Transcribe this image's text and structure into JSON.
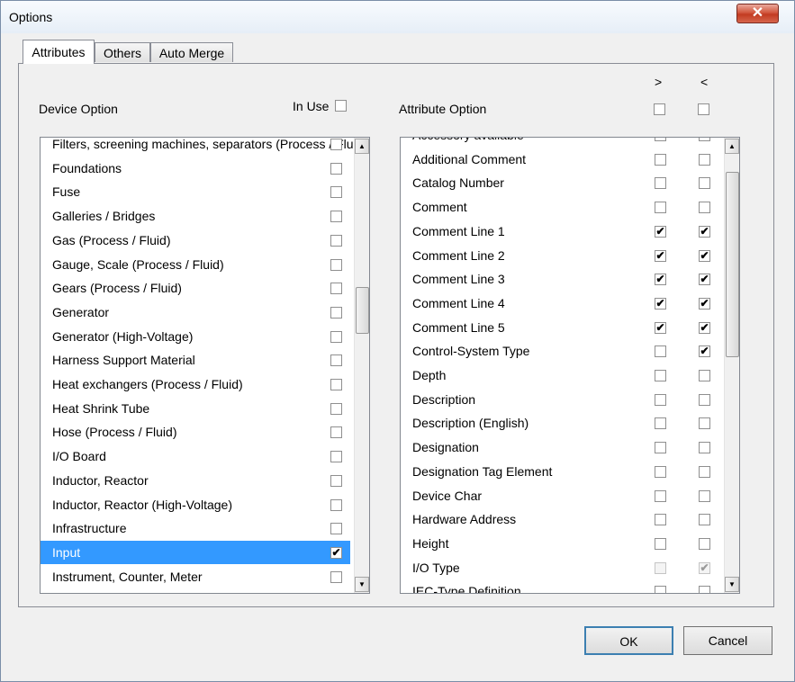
{
  "window": {
    "title": "Options",
    "close_glyph": "✕"
  },
  "tabs": [
    {
      "label": "Attributes",
      "active": true
    },
    {
      "label": "Others",
      "active": false
    },
    {
      "label": "Auto Merge",
      "active": false
    }
  ],
  "device": {
    "heading": "Device Option",
    "in_use_label": "In Use",
    "items": [
      {
        "label": "Filters, screening machines, separators (Process / Fluid)",
        "checked": false
      },
      {
        "label": "Foundations",
        "checked": false
      },
      {
        "label": "Fuse",
        "checked": false
      },
      {
        "label": "Galleries / Bridges",
        "checked": false
      },
      {
        "label": "Gas (Process / Fluid)",
        "checked": false
      },
      {
        "label": "Gauge, Scale (Process / Fluid)",
        "checked": false
      },
      {
        "label": "Gears (Process / Fluid)",
        "checked": false
      },
      {
        "label": "Generator",
        "checked": false
      },
      {
        "label": "Generator (High-Voltage)",
        "checked": false
      },
      {
        "label": "Harness Support Material",
        "checked": false
      },
      {
        "label": "Heat exchangers (Process / Fluid)",
        "checked": false
      },
      {
        "label": "Heat Shrink Tube",
        "checked": false
      },
      {
        "label": "Hose (Process / Fluid)",
        "checked": false
      },
      {
        "label": "I/O Board",
        "checked": false
      },
      {
        "label": "Inductor, Reactor",
        "checked": false
      },
      {
        "label": "Inductor, Reactor (High-Voltage)",
        "checked": false
      },
      {
        "label": "Infrastructure",
        "checked": false
      },
      {
        "label": "Input",
        "checked": true,
        "selected": true
      },
      {
        "label": "Instrument, Counter, Meter",
        "checked": false
      }
    ]
  },
  "attribute": {
    "heading": "Attribute Option",
    "col_gt": ">",
    "col_lt": "<",
    "items": [
      {
        "label": "Accessory available",
        "gt": false,
        "lt": false
      },
      {
        "label": "Additional Comment",
        "gt": false,
        "lt": false
      },
      {
        "label": "Catalog Number",
        "gt": false,
        "lt": false
      },
      {
        "label": "Comment",
        "gt": false,
        "lt": false
      },
      {
        "label": "Comment Line 1",
        "gt": true,
        "lt": true
      },
      {
        "label": "Comment Line 2",
        "gt": true,
        "lt": true
      },
      {
        "label": "Comment Line 3",
        "gt": true,
        "lt": true
      },
      {
        "label": "Comment Line 4",
        "gt": true,
        "lt": true
      },
      {
        "label": "Comment Line 5",
        "gt": true,
        "lt": true
      },
      {
        "label": "Control-System Type",
        "gt": false,
        "lt": true
      },
      {
        "label": "Depth",
        "gt": false,
        "lt": false
      },
      {
        "label": "Description",
        "gt": false,
        "lt": false
      },
      {
        "label": "Description (English)",
        "gt": false,
        "lt": false
      },
      {
        "label": "Designation",
        "gt": false,
        "lt": false
      },
      {
        "label": "Designation Tag Element",
        "gt": false,
        "lt": false
      },
      {
        "label": "Device Char",
        "gt": false,
        "lt": false
      },
      {
        "label": "Hardware Address",
        "gt": false,
        "lt": false
      },
      {
        "label": "Height",
        "gt": false,
        "lt": false
      },
      {
        "label": "I/O Type",
        "gt": false,
        "lt": true,
        "disabled": true
      },
      {
        "label": "IEC-Type Definition",
        "gt": false,
        "lt": false
      }
    ]
  },
  "buttons": {
    "ok": "OK",
    "cancel": "Cancel"
  },
  "icons": {
    "check": "✔",
    "scroll_up": "▲",
    "scroll_down": "▼"
  },
  "colors": {
    "selection": "#3399ff",
    "close": "#c23b21"
  }
}
